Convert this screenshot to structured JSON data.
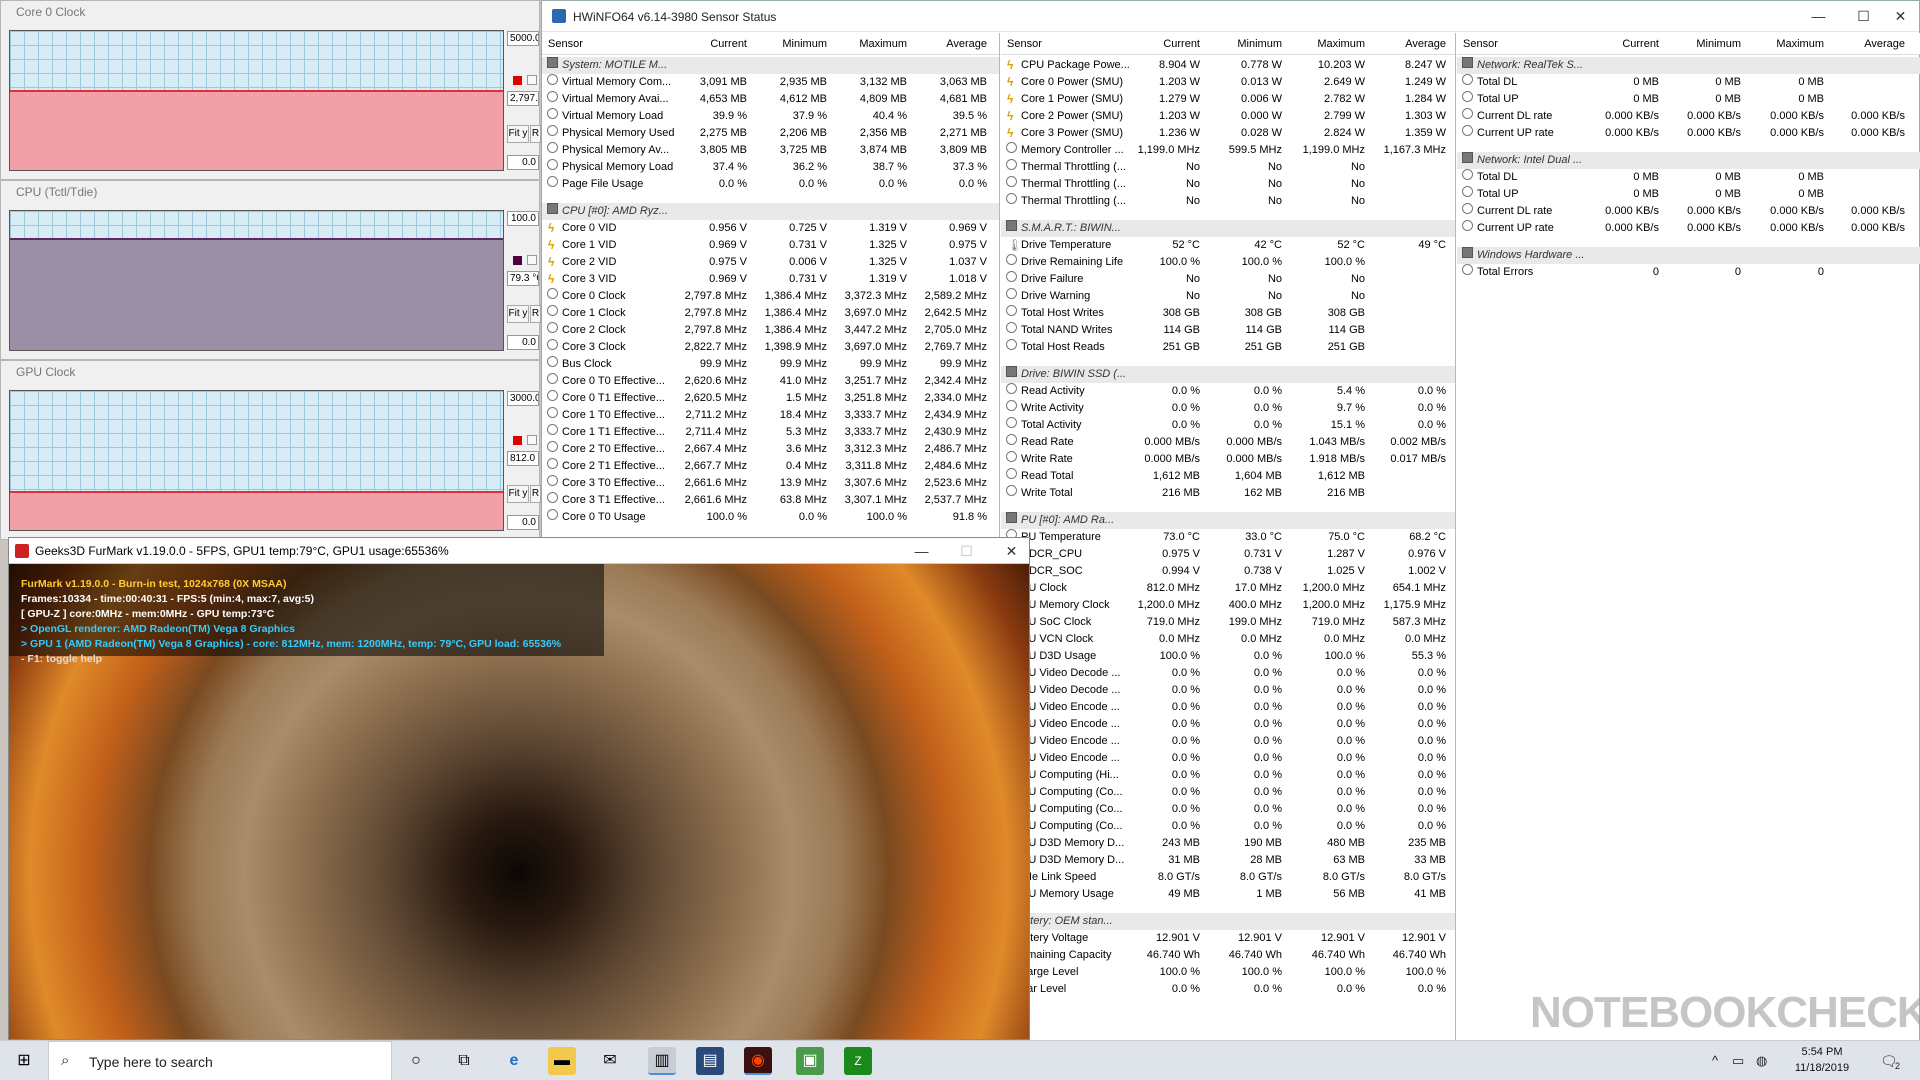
{
  "graphs": [
    {
      "title": "Core 0 Clock",
      "max": "5000.0",
      "current": "2,797.8",
      "min": "0.0",
      "fit": "Fit y",
      "r": "R",
      "fill_color": "#f0a0a6",
      "line_color": "#e03040",
      "sq_color": "#e00000",
      "fill_level": 0.56
    },
    {
      "title": "CPU (Tctl/Tdie)",
      "max": "100.0",
      "current": "79.3 °C",
      "min": "0.0",
      "fit": "Fit y",
      "r": "R",
      "fill_color": "#9b8fa6",
      "line_color": "#5a2a60",
      "sq_color": "#500040",
      "fill_level": 0.79
    },
    {
      "title": "GPU Clock",
      "max": "3000.0",
      "current": "812.0 M",
      "min": "0.0",
      "fit": "Fit y",
      "r": "R",
      "fill_color": "#f0a0a6",
      "line_color": "#e03040",
      "sq_color": "#e00000",
      "fill_level": 0.27
    }
  ],
  "hwinfo": {
    "title": "HWiNFO64 v6.14-3980 Sensor Status",
    "controls": {
      "minimize": "—",
      "maximize": "☐",
      "close": "✕"
    },
    "columns": [
      "Sensor",
      "Current",
      "Minimum",
      "Maximum",
      "Average"
    ],
    "panes": [
      {
        "rows": [
          {
            "g": "System: MOTILE M..."
          },
          {
            "n": "Virtual Memory Com...",
            "v": [
              "3,091 MB",
              "2,935 MB",
              "3,132 MB",
              "3,063 MB"
            ]
          },
          {
            "n": "Virtual Memory Avai...",
            "v": [
              "4,653 MB",
              "4,612 MB",
              "4,809 MB",
              "4,681 MB"
            ]
          },
          {
            "n": "Virtual Memory Load",
            "v": [
              "39.9 %",
              "37.9 %",
              "40.4 %",
              "39.5 %"
            ]
          },
          {
            "n": "Physical Memory Used",
            "v": [
              "2,275 MB",
              "2,206 MB",
              "2,356 MB",
              "2,271 MB"
            ]
          },
          {
            "n": "Physical Memory Av...",
            "v": [
              "3,805 MB",
              "3,725 MB",
              "3,874 MB",
              "3,809 MB"
            ]
          },
          {
            "n": "Physical Memory Load",
            "v": [
              "37.4 %",
              "36.2 %",
              "38.7 %",
              "37.3 %"
            ]
          },
          {
            "n": "Page File Usage",
            "v": [
              "0.0 %",
              "0.0 %",
              "0.0 %",
              "0.0 %"
            ]
          },
          {
            "b": 1
          },
          {
            "g": "CPU [#0]: AMD Ryz..."
          },
          {
            "n": "Core 0 VID",
            "i": "volt",
            "v": [
              "0.956 V",
              "0.725 V",
              "1.319 V",
              "0.969 V"
            ]
          },
          {
            "n": "Core 1 VID",
            "i": "volt",
            "v": [
              "0.969 V",
              "0.731 V",
              "1.325 V",
              "0.975 V"
            ]
          },
          {
            "n": "Core 2 VID",
            "i": "volt",
            "v": [
              "0.975 V",
              "0.006 V",
              "1.325 V",
              "1.037 V"
            ]
          },
          {
            "n": "Core 3 VID",
            "i": "volt",
            "v": [
              "0.969 V",
              "0.731 V",
              "1.319 V",
              "1.018 V"
            ]
          },
          {
            "n": "Core 0 Clock",
            "v": [
              "2,797.8 MHz",
              "1,386.4 MHz",
              "3,372.3 MHz",
              "2,589.2 MHz"
            ]
          },
          {
            "n": "Core 1 Clock",
            "v": [
              "2,797.8 MHz",
              "1,386.4 MHz",
              "3,697.0 MHz",
              "2,642.5 MHz"
            ]
          },
          {
            "n": "Core 2 Clock",
            "v": [
              "2,797.8 MHz",
              "1,386.4 MHz",
              "3,447.2 MHz",
              "2,705.0 MHz"
            ]
          },
          {
            "n": "Core 3 Clock",
            "v": [
              "2,822.7 MHz",
              "1,398.9 MHz",
              "3,697.0 MHz",
              "2,769.7 MHz"
            ]
          },
          {
            "n": "Bus Clock",
            "v": [
              "99.9 MHz",
              "99.9 MHz",
              "99.9 MHz",
              "99.9 MHz"
            ]
          },
          {
            "n": "Core 0 T0 Effective...",
            "v": [
              "2,620.6 MHz",
              "41.0 MHz",
              "3,251.7 MHz",
              "2,342.4 MHz"
            ]
          },
          {
            "n": "Core 0 T1 Effective...",
            "v": [
              "2,620.5 MHz",
              "1.5 MHz",
              "3,251.8 MHz",
              "2,334.0 MHz"
            ]
          },
          {
            "n": "Core 1 T0 Effective...",
            "v": [
              "2,711.2 MHz",
              "18.4 MHz",
              "3,333.7 MHz",
              "2,434.9 MHz"
            ]
          },
          {
            "n": "Core 1 T1 Effective...",
            "v": [
              "2,711.4 MHz",
              "5.3 MHz",
              "3,333.7 MHz",
              "2,430.9 MHz"
            ]
          },
          {
            "n": "Core 2 T0 Effective...",
            "v": [
              "2,667.4 MHz",
              "3.6 MHz",
              "3,312.3 MHz",
              "2,486.7 MHz"
            ]
          },
          {
            "n": "Core 2 T1 Effective...",
            "v": [
              "2,667.7 MHz",
              "0.4 MHz",
              "3,311.8 MHz",
              "2,484.6 MHz"
            ]
          },
          {
            "n": "Core 3 T0 Effective...",
            "v": [
              "2,661.6 MHz",
              "13.9 MHz",
              "3,307.6 MHz",
              "2,523.6 MHz"
            ]
          },
          {
            "n": "Core 3 T1 Effective...",
            "v": [
              "2,661.6 MHz",
              "63.8 MHz",
              "3,307.1 MHz",
              "2,537.7 MHz"
            ]
          },
          {
            "n": "Core 0 T0 Usage",
            "v": [
              "100.0 %",
              "0.0 %",
              "100.0 %",
              "91.8 %"
            ]
          }
        ]
      },
      {
        "rows": [
          {
            "n": "CPU Package Powe...",
            "i": "volt",
            "v": [
              "8.904 W",
              "0.778 W",
              "10.203 W",
              "8.247 W"
            ]
          },
          {
            "n": "Core 0 Power (SMU)",
            "i": "volt",
            "v": [
              "1.203 W",
              "0.013 W",
              "2.649 W",
              "1.249 W"
            ]
          },
          {
            "n": "Core 1 Power (SMU)",
            "i": "volt",
            "v": [
              "1.279 W",
              "0.006 W",
              "2.782 W",
              "1.284 W"
            ]
          },
          {
            "n": "Core 2 Power (SMU)",
            "i": "volt",
            "v": [
              "1.203 W",
              "0.000 W",
              "2.799 W",
              "1.303 W"
            ]
          },
          {
            "n": "Core 3 Power (SMU)",
            "i": "volt",
            "v": [
              "1.236 W",
              "0.028 W",
              "2.824 W",
              "1.359 W"
            ]
          },
          {
            "n": "Memory Controller ...",
            "v": [
              "1,199.0 MHz",
              "599.5 MHz",
              "1,199.0 MHz",
              "1,167.3 MHz"
            ]
          },
          {
            "n": "Thermal Throttling (...",
            "v": [
              "No",
              "No",
              "No",
              ""
            ]
          },
          {
            "n": "Thermal Throttling (...",
            "v": [
              "No",
              "No",
              "No",
              ""
            ]
          },
          {
            "n": "Thermal Throttling (...",
            "v": [
              "No",
              "No",
              "No",
              ""
            ]
          },
          {
            "b": 1
          },
          {
            "g": "S.M.A.R.T.: BIWIN..."
          },
          {
            "n": "Drive Temperature",
            "i": "temp",
            "v": [
              "52 °C",
              "42 °C",
              "52 °C",
              "49 °C"
            ]
          },
          {
            "n": "Drive Remaining Life",
            "v": [
              "100.0 %",
              "100.0 %",
              "100.0 %",
              ""
            ]
          },
          {
            "n": "Drive Failure",
            "v": [
              "No",
              "No",
              "No",
              ""
            ]
          },
          {
            "n": "Drive Warning",
            "v": [
              "No",
              "No",
              "No",
              ""
            ]
          },
          {
            "n": "Total Host Writes",
            "v": [
              "308 GB",
              "308 GB",
              "308 GB",
              ""
            ]
          },
          {
            "n": "Total NAND Writes",
            "v": [
              "114 GB",
              "114 GB",
              "114 GB",
              ""
            ]
          },
          {
            "n": "Total Host Reads",
            "v": [
              "251 GB",
              "251 GB",
              "251 GB",
              ""
            ]
          },
          {
            "b": 1
          },
          {
            "g": "Drive: BIWIN SSD (..."
          },
          {
            "n": "Read Activity",
            "v": [
              "0.0 %",
              "0.0 %",
              "5.4 %",
              "0.0 %"
            ]
          },
          {
            "n": "Write Activity",
            "v": [
              "0.0 %",
              "0.0 %",
              "9.7 %",
              "0.0 %"
            ]
          },
          {
            "n": "Total Activity",
            "v": [
              "0.0 %",
              "0.0 %",
              "15.1 %",
              "0.0 %"
            ]
          },
          {
            "n": "Read Rate",
            "v": [
              "0.000 MB/s",
              "0.000 MB/s",
              "1.043 MB/s",
              "0.002 MB/s"
            ]
          },
          {
            "n": "Write Rate",
            "v": [
              "0.000 MB/s",
              "0.000 MB/s",
              "1.918 MB/s",
              "0.017 MB/s"
            ]
          },
          {
            "n": "Read Total",
            "v": [
              "1,612 MB",
              "1,604 MB",
              "1,612 MB",
              ""
            ]
          },
          {
            "n": "Write Total",
            "v": [
              "216 MB",
              "162 MB",
              "216 MB",
              ""
            ]
          },
          {
            "b": 1
          },
          {
            "g": "PU [#0]: AMD Ra..."
          },
          {
            "n": "PU Temperature",
            "v": [
              "73.0 °C",
              "33.0 °C",
              "75.0 °C",
              "68.2 °C"
            ]
          },
          {
            "n": "DDCR_CPU",
            "v": [
              "0.975 V",
              "0.731 V",
              "1.287 V",
              "0.976 V"
            ]
          },
          {
            "n": "DDCR_SOC",
            "v": [
              "0.994 V",
              "0.738 V",
              "1.025 V",
              "1.002 V"
            ]
          },
          {
            "n": "PU Clock",
            "v": [
              "812.0 MHz",
              "17.0 MHz",
              "1,200.0 MHz",
              "654.1 MHz"
            ]
          },
          {
            "n": "PU Memory Clock",
            "v": [
              "1,200.0 MHz",
              "400.0 MHz",
              "1,200.0 MHz",
              "1,175.9 MHz"
            ]
          },
          {
            "n": "PU SoC Clock",
            "v": [
              "719.0 MHz",
              "199.0 MHz",
              "719.0 MHz",
              "587.3 MHz"
            ]
          },
          {
            "n": "PU VCN Clock",
            "v": [
              "0.0 MHz",
              "0.0 MHz",
              "0.0 MHz",
              "0.0 MHz"
            ]
          },
          {
            "n": "PU D3D Usage",
            "v": [
              "100.0 %",
              "0.0 %",
              "100.0 %",
              "55.3 %"
            ]
          },
          {
            "n": "PU Video Decode ...",
            "v": [
              "0.0 %",
              "0.0 %",
              "0.0 %",
              "0.0 %"
            ]
          },
          {
            "n": "PU Video Decode ...",
            "v": [
              "0.0 %",
              "0.0 %",
              "0.0 %",
              "0.0 %"
            ]
          },
          {
            "n": "PU Video Encode ...",
            "v": [
              "0.0 %",
              "0.0 %",
              "0.0 %",
              "0.0 %"
            ]
          },
          {
            "n": "PU Video Encode ...",
            "v": [
              "0.0 %",
              "0.0 %",
              "0.0 %",
              "0.0 %"
            ]
          },
          {
            "n": "PU Video Encode ...",
            "v": [
              "0.0 %",
              "0.0 %",
              "0.0 %",
              "0.0 %"
            ]
          },
          {
            "n": "PU Video Encode ...",
            "v": [
              "0.0 %",
              "0.0 %",
              "0.0 %",
              "0.0 %"
            ]
          },
          {
            "n": "PU Computing (Hi...",
            "v": [
              "0.0 %",
              "0.0 %",
              "0.0 %",
              "0.0 %"
            ]
          },
          {
            "n": "PU Computing (Co...",
            "v": [
              "0.0 %",
              "0.0 %",
              "0.0 %",
              "0.0 %"
            ]
          },
          {
            "n": "PU Computing (Co...",
            "v": [
              "0.0 %",
              "0.0 %",
              "0.0 %",
              "0.0 %"
            ]
          },
          {
            "n": "PU Computing (Co...",
            "v": [
              "0.0 %",
              "0.0 %",
              "0.0 %",
              "0.0 %"
            ]
          },
          {
            "n": "PU D3D Memory D...",
            "v": [
              "243 MB",
              "190 MB",
              "480 MB",
              "235 MB"
            ]
          },
          {
            "n": "PU D3D Memory D...",
            "v": [
              "31 MB",
              "28 MB",
              "63 MB",
              "33 MB"
            ]
          },
          {
            "n": "CIe Link Speed",
            "v": [
              "8.0 GT/s",
              "8.0 GT/s",
              "8.0 GT/s",
              "8.0 GT/s"
            ]
          },
          {
            "n": "PU Memory Usage",
            "v": [
              "49 MB",
              "1 MB",
              "56 MB",
              "41 MB"
            ]
          },
          {
            "b": 1
          },
          {
            "g": "attery: OEM stan..."
          },
          {
            "n": "attery Voltage",
            "v": [
              "12.901 V",
              "12.901 V",
              "12.901 V",
              "12.901 V"
            ]
          },
          {
            "n": "emaining Capacity",
            "v": [
              "46.740 Wh",
              "46.740 Wh",
              "46.740 Wh",
              "46.740 Wh"
            ]
          },
          {
            "n": "harge Level",
            "v": [
              "100.0 %",
              "100.0 %",
              "100.0 %",
              "100.0 %"
            ]
          },
          {
            "n": "ear Level",
            "v": [
              "0.0 %",
              "0.0 %",
              "0.0 %",
              "0.0 %"
            ]
          }
        ]
      },
      {
        "rows": [
          {
            "g": "Network: RealTek S..."
          },
          {
            "n": "Total DL",
            "v": [
              "0 MB",
              "0 MB",
              "0 MB",
              ""
            ]
          },
          {
            "n": "Total UP",
            "v": [
              "0 MB",
              "0 MB",
              "0 MB",
              ""
            ]
          },
          {
            "n": "Current DL rate",
            "v": [
              "0.000 KB/s",
              "0.000 KB/s",
              "0.000 KB/s",
              "0.000 KB/s"
            ]
          },
          {
            "n": "Current UP rate",
            "v": [
              "0.000 KB/s",
              "0.000 KB/s",
              "0.000 KB/s",
              "0.000 KB/s"
            ]
          },
          {
            "b": 1
          },
          {
            "g": "Network: Intel Dual ..."
          },
          {
            "n": "Total DL",
            "v": [
              "0 MB",
              "0 MB",
              "0 MB",
              ""
            ]
          },
          {
            "n": "Total UP",
            "v": [
              "0 MB",
              "0 MB",
              "0 MB",
              ""
            ]
          },
          {
            "n": "Current DL rate",
            "v": [
              "0.000 KB/s",
              "0.000 KB/s",
              "0.000 KB/s",
              "0.000 KB/s"
            ]
          },
          {
            "n": "Current UP rate",
            "v": [
              "0.000 KB/s",
              "0.000 KB/s",
              "0.000 KB/s",
              "0.000 KB/s"
            ]
          },
          {
            "b": 1
          },
          {
            "g": "Windows Hardware ..."
          },
          {
            "n": "Total Errors",
            "v": [
              "0",
              "0",
              "0",
              ""
            ]
          }
        ]
      }
    ]
  },
  "furmark": {
    "title": "Geeks3D FurMark v1.19.0.0 - 5FPS, GPU1 temp:79°C, GPU1 usage:65536%",
    "controls": {
      "minimize": "—",
      "maximize": "☐",
      "close": "✕"
    },
    "lines": [
      {
        "text": "FurMark v1.19.0.0 - Burn-in test, 1024x768 (0X MSAA)",
        "color": "#ffcc33"
      },
      {
        "text": "Frames:10334 - time:00:40:31 - FPS:5 (min:4, max:7, avg:5)",
        "color": "#ffffff"
      },
      {
        "text": "[ GPU-Z ] core:0MHz - mem:0MHz - GPU temp:73°C",
        "color": "#ffffff"
      },
      {
        "text": "> OpenGL renderer: AMD Radeon(TM) Vega 8 Graphics",
        "color": "#33ccff"
      },
      {
        "text": "> GPU 1 (AMD Radeon(TM) Vega 8 Graphics) - core: 812MHz, mem: 1200MHz, temp: 79°C, GPU load: 65536%",
        "color": "#33ccff"
      },
      {
        "text": "- F1: toggle help",
        "color": "#dddddd"
      }
    ]
  },
  "taskbar": {
    "search_placeholder": "Type here to search",
    "time": "5:54 PM",
    "date": "11/18/2019",
    "notification_count": "2"
  },
  "watermark": {
    "text": "NOTEBOOKCHECK"
  }
}
